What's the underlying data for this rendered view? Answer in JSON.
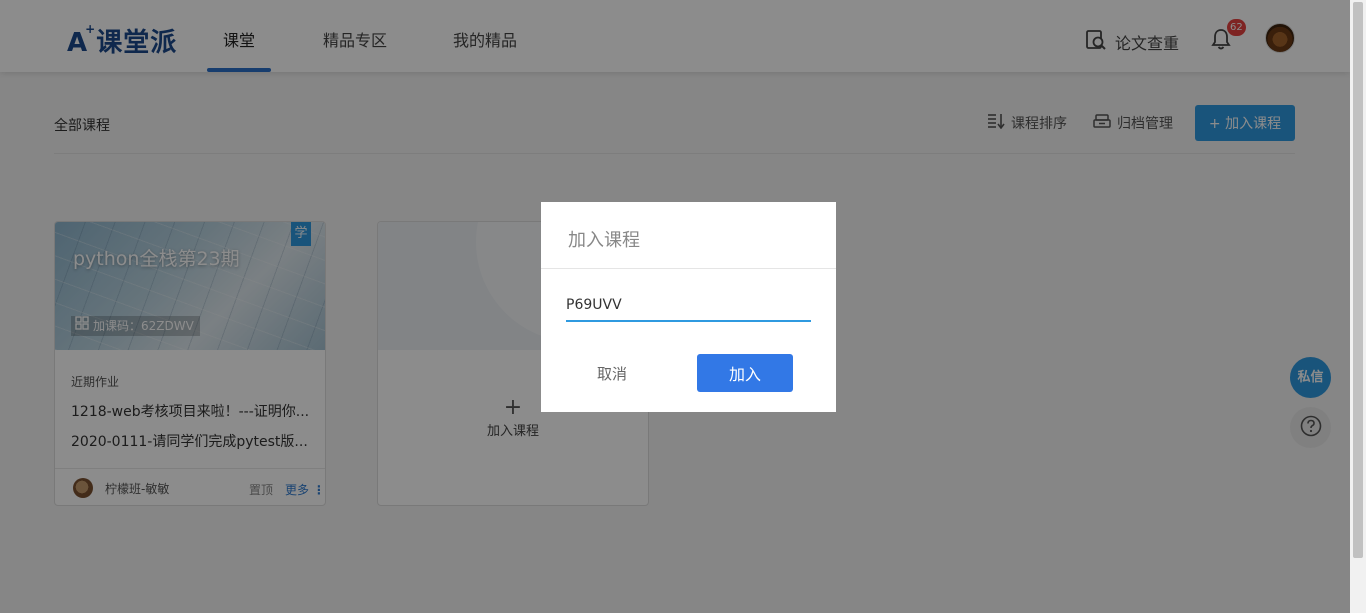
{
  "header": {
    "logo_mark": "A",
    "logo_plus": "+",
    "logo_text": "课堂派",
    "nav": [
      {
        "label": "课堂",
        "active": true
      },
      {
        "label": "精品专区",
        "active": false
      },
      {
        "label": "我的精品",
        "active": false
      }
    ],
    "checker_label": "论文查重",
    "notification_count": "62"
  },
  "toolbar": {
    "all_courses": "全部课程",
    "sort_label": "课程排序",
    "archive_label": "归档管理",
    "join_label": "+ 加入课程"
  },
  "course_card": {
    "title": "python全栈第23期",
    "role_tag": "学",
    "code_label": "加课码：62ZDWV",
    "homework_label": "近期作业",
    "homework": [
      "1218-web考核项目来啦！---证明你...",
      "2020-0111-请同学们完成pytest版..."
    ],
    "teacher": "柠檬班-敏敏",
    "pin_label": "置顶",
    "more_label": "更多"
  },
  "add_card": {
    "plus": "+",
    "label": "加入课程"
  },
  "floating": {
    "message_label": "私信",
    "help_icon": "question-circle-icon"
  },
  "dialog": {
    "title": "加入课程",
    "input_value": "P69UVV",
    "cancel_label": "取消",
    "confirm_label": "加入"
  },
  "colors": {
    "accent": "#2f9ae0",
    "primary_button": "#3278e6",
    "badge": "#e64340",
    "logo": "#1d4a8c"
  }
}
